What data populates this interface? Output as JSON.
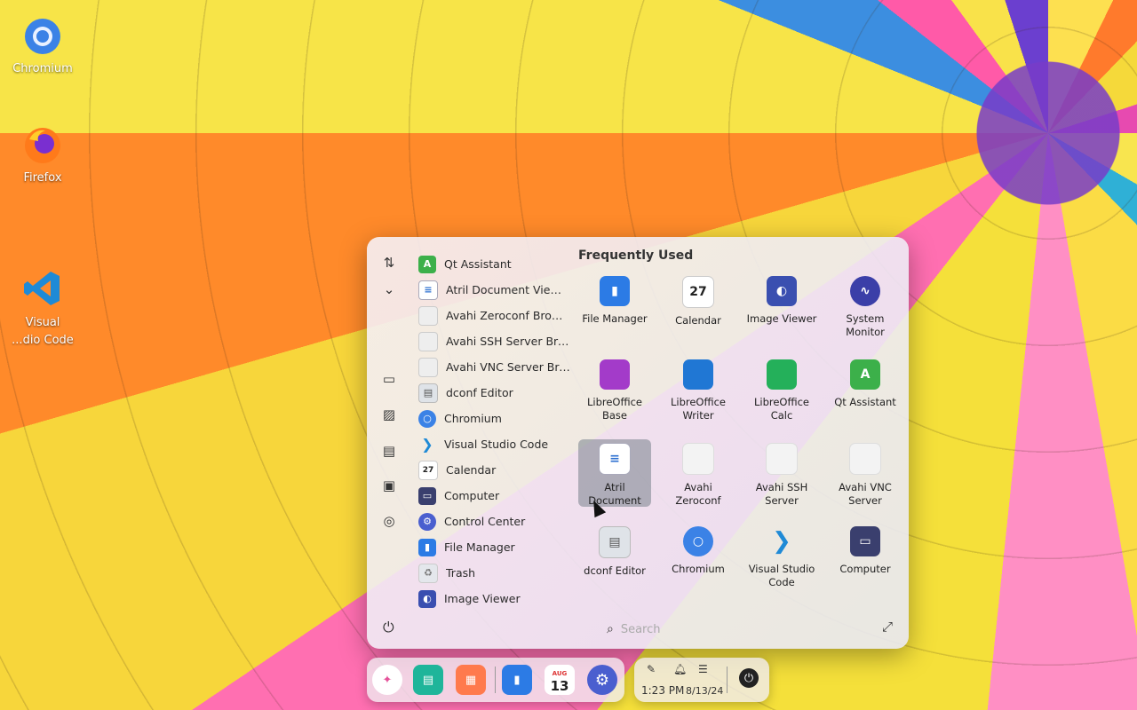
{
  "desktop": {
    "icons": [
      {
        "label": "Chromium",
        "icon": "chromium-icon"
      },
      {
        "label": "Firefox",
        "icon": "firefox-icon"
      },
      {
        "label": "Visual\n...dio Code",
        "icon": "vscode-icon"
      }
    ]
  },
  "menu": {
    "sidebar_icons": [
      "sort-icon",
      "chevron-down-icon",
      "monitor-icon",
      "image-icon",
      "document-icon",
      "display-icon",
      "globe-icon",
      "power-icon"
    ],
    "list": [
      {
        "label": "Qt Assistant",
        "icon": "qt-assistant-icon"
      },
      {
        "label": "Atril Document Viewer",
        "icon": "atril-icon"
      },
      {
        "label": "Avahi Zeroconf Browser",
        "icon": "avahi-icon"
      },
      {
        "label": "Avahi SSH Server Brow...",
        "icon": "avahi-icon"
      },
      {
        "label": "Avahi VNC Server Bro...",
        "icon": "avahi-icon"
      },
      {
        "label": "dconf Editor",
        "icon": "dconf-icon"
      },
      {
        "label": "Chromium",
        "icon": "chromium-icon"
      },
      {
        "label": "Visual Studio Code",
        "icon": "vscode-icon"
      },
      {
        "label": "Calendar",
        "icon": "calendar-icon"
      },
      {
        "label": "Computer",
        "icon": "computer-icon"
      },
      {
        "label": "Control Center",
        "icon": "settings-icon"
      },
      {
        "label": "File Manager",
        "icon": "file-manager-icon"
      },
      {
        "label": "Trash",
        "icon": "trash-icon"
      },
      {
        "label": "Image Viewer",
        "icon": "image-viewer-icon"
      }
    ],
    "frequent_title": "Frequently Used",
    "frequent": [
      {
        "label": "File Manager",
        "icon": "file-manager-icon"
      },
      {
        "label": "Calendar",
        "icon": "calendar-icon"
      },
      {
        "label": "Image Viewer",
        "icon": "image-viewer-icon"
      },
      {
        "label": "System\nMonitor",
        "icon": "system-monitor-icon"
      },
      {
        "label": "LibreOffice\nBase",
        "icon": "libreoffice-base-icon"
      },
      {
        "label": "LibreOffice\nWriter",
        "icon": "libreoffice-writer-icon"
      },
      {
        "label": "LibreOffice\nCalc",
        "icon": "libreoffice-calc-icon"
      },
      {
        "label": "Qt Assistant",
        "icon": "qt-assistant-icon"
      },
      {
        "label": "Atril\nDocument",
        "icon": "atril-icon",
        "selected": true
      },
      {
        "label": "Avahi\nZeroconf",
        "icon": "avahi-icon"
      },
      {
        "label": "Avahi SSH\nServer",
        "icon": "avahi-icon"
      },
      {
        "label": "Avahi VNC\nServer",
        "icon": "avahi-icon"
      },
      {
        "label": "dconf Editor",
        "icon": "dconf-icon"
      },
      {
        "label": "Chromium",
        "icon": "chromium-icon"
      },
      {
        "label": "Visual Studio\nCode",
        "icon": "vscode-icon"
      },
      {
        "label": "Computer",
        "icon": "computer-icon"
      }
    ],
    "search_placeholder": "Search"
  },
  "taskbar": {
    "dock": [
      "launcher-icon",
      "multitasking-icon",
      "app-store-icon",
      "file-manager-icon",
      "calendar-icon",
      "settings-icon"
    ],
    "calendar_month": "AUG",
    "calendar_day": "13",
    "tray": {
      "time": "1:23 PM",
      "date": "8/13/24"
    }
  },
  "colors": {
    "menu_bg": "#f2eef4",
    "selected_tile": "#7a828c",
    "accent_blue": "#2c7be5"
  }
}
